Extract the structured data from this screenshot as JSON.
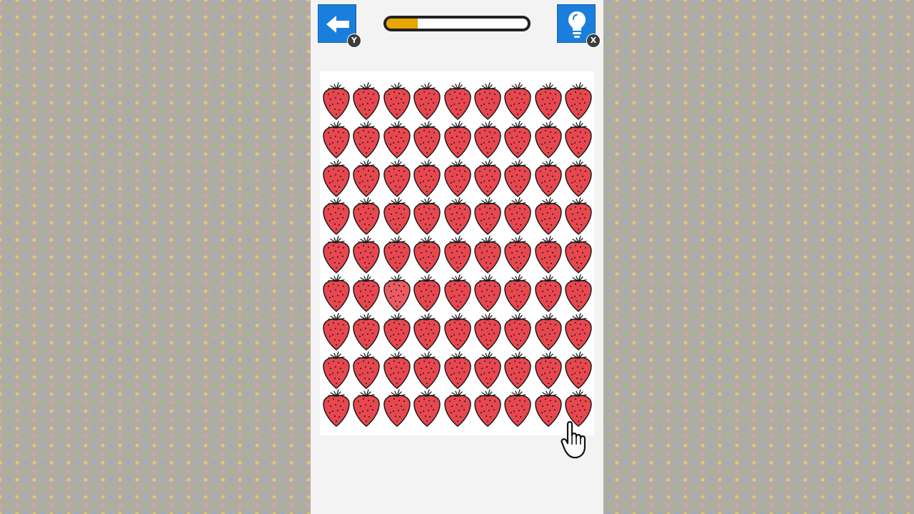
{
  "header": {
    "back_button": {
      "icon": "left-arrow-icon",
      "shortcut": "Y"
    },
    "hint_button": {
      "icon": "lightbulb-icon",
      "shortcut": "X"
    },
    "progress": {
      "value": 0.22,
      "fill_color": "#e8a600"
    }
  },
  "board": {
    "rows": 9,
    "columns": 9,
    "item": "strawberry",
    "item_color": "#e8474f",
    "odd_one_out_color": "#ec5a62",
    "odd_one_out": {
      "row": 6,
      "column": 3
    }
  },
  "cursor": {
    "icon": "pointing-hand-icon"
  },
  "colors": {
    "button_blue": "#1a7fdc",
    "panel_background": "#f3f3f3"
  }
}
